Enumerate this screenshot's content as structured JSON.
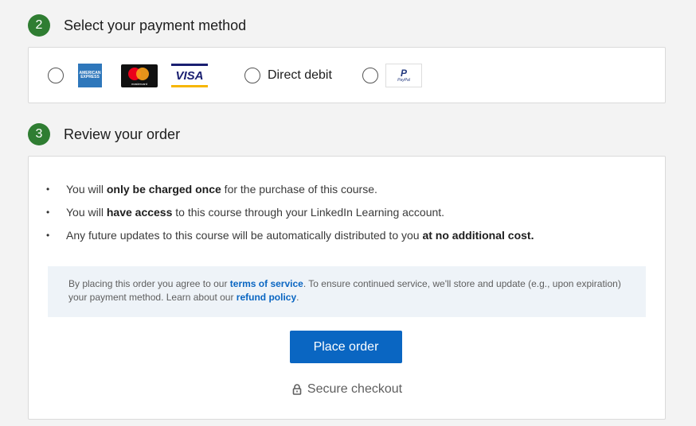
{
  "steps": {
    "payment": {
      "number": "2",
      "title": "Select your payment method"
    },
    "review": {
      "number": "3",
      "title": "Review your order"
    }
  },
  "payment_methods": {
    "amex_text_1": "AMERICAN",
    "amex_text_2": "EXPRESS",
    "mastercard_text": "mastercard",
    "visa_text": "VISA",
    "direct_debit_label": "Direct debit",
    "paypal_mark": "P",
    "paypal_text": "PayPal"
  },
  "review": {
    "bullet1": {
      "pre": "You will ",
      "bold": "only be charged once",
      "post": " for the purchase of this course."
    },
    "bullet2": {
      "pre": "You will ",
      "bold": "have access",
      "post": " to this course through your LinkedIn Learning account."
    },
    "bullet3": {
      "pre": "Any future updates to this course will be automatically distributed to you ",
      "bold": "at no additional cost."
    },
    "notice": {
      "pre": "By placing this order you agree to our ",
      "link1": "terms of service",
      "mid": ". To ensure continued service, we'll store and update (e.g., upon expiration) your payment method. Learn about our ",
      "link2": "refund policy",
      "post": "."
    },
    "place_order": "Place order",
    "secure_checkout": "Secure checkout"
  },
  "colors": {
    "step_badge": "#2f7d32",
    "primary": "#0a66c2",
    "notice_bg": "#eef3f8"
  }
}
